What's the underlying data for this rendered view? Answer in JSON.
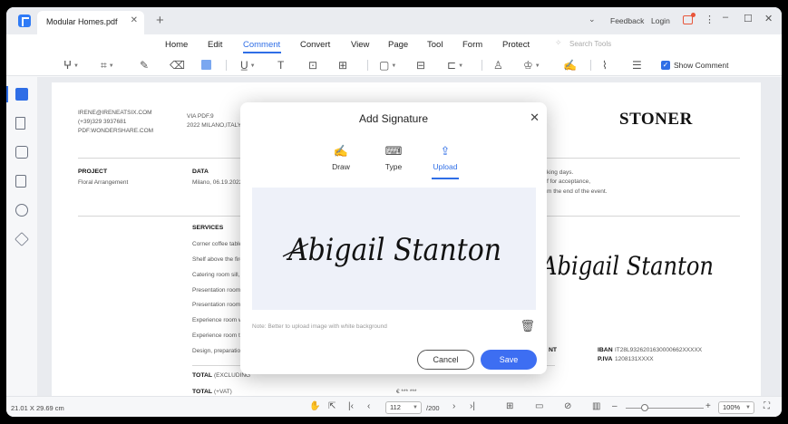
{
  "titlebar": {
    "tab_label": "Modular Homes.pdf",
    "tab_close": "✕",
    "new_tab": "+",
    "feedback": "Feedback",
    "login": "Login"
  },
  "menu": {
    "items": [
      "Home",
      "Edit",
      "Comment",
      "Convert",
      "View",
      "Page",
      "Tool",
      "Form",
      "Protect"
    ],
    "active": "Comment",
    "search_placeholder": "Search Tools"
  },
  "toolbar": {
    "show_comment_label": "Show Comment",
    "show_comment_checked": true
  },
  "document": {
    "contact": [
      "IRENE@IRENEATSIX.COM",
      "(+39)329 3937681",
      "PDF.WONDERSHARE.COM"
    ],
    "address": [
      "VIA PDF.9",
      "2022 MILANO,ITALY"
    ],
    "brand": "STONER",
    "project_heading": "PROJECT",
    "project_value": "Floral Arrangement",
    "date_heading": "DATA",
    "date_value": "Milano, 06.19.2022",
    "terms_lines": [
      "king days.",
      "f for acceptance,",
      "m the end of the event."
    ],
    "services_heading": "SERVICES",
    "services": [
      "Corner coffee table",
      "Shelf above the fire",
      "Catering room sill, r",
      "Presentation room",
      "Presentation room",
      "Experience room wi",
      "Experience room ta",
      "Design, preparation"
    ],
    "payment_label": "NT",
    "iban_label": "IBAN",
    "iban_value": "IT28L9326201630000662XXXXX",
    "piva_label": "P.IVA",
    "piva_value": "1208131XXXX",
    "total_excl_label": "TOTAL",
    "total_excl_suffix": "(EXCLUDING",
    "total_vat_label": "TOTAL",
    "total_vat_suffix": "(+VAT)",
    "total_vat_value": "€ *** ***",
    "signature_text": "Abigail Stanton"
  },
  "dialog": {
    "title": "Add Signature",
    "close": "✕",
    "tabs": [
      {
        "label": "Draw",
        "icon": "pen-draw-icon"
      },
      {
        "label": "Type",
        "icon": "keyboard-icon"
      },
      {
        "label": "Upload",
        "icon": "upload-icon"
      }
    ],
    "active_tab": "Upload",
    "signature_text": "Abigail Stanton",
    "note": "Note: Better to upload image with white background",
    "cancel_label": "Cancel",
    "save_label": "Save"
  },
  "statusbar": {
    "page_size": "21.01 X 29.69 cm",
    "current_page": "112",
    "total_pages": "/200",
    "zoom": "100%"
  },
  "colors": {
    "accent": "#2f6ee6",
    "save_button": "#3d6ef2",
    "signature_area": "#eef1f9",
    "notification": "#e8553a"
  }
}
